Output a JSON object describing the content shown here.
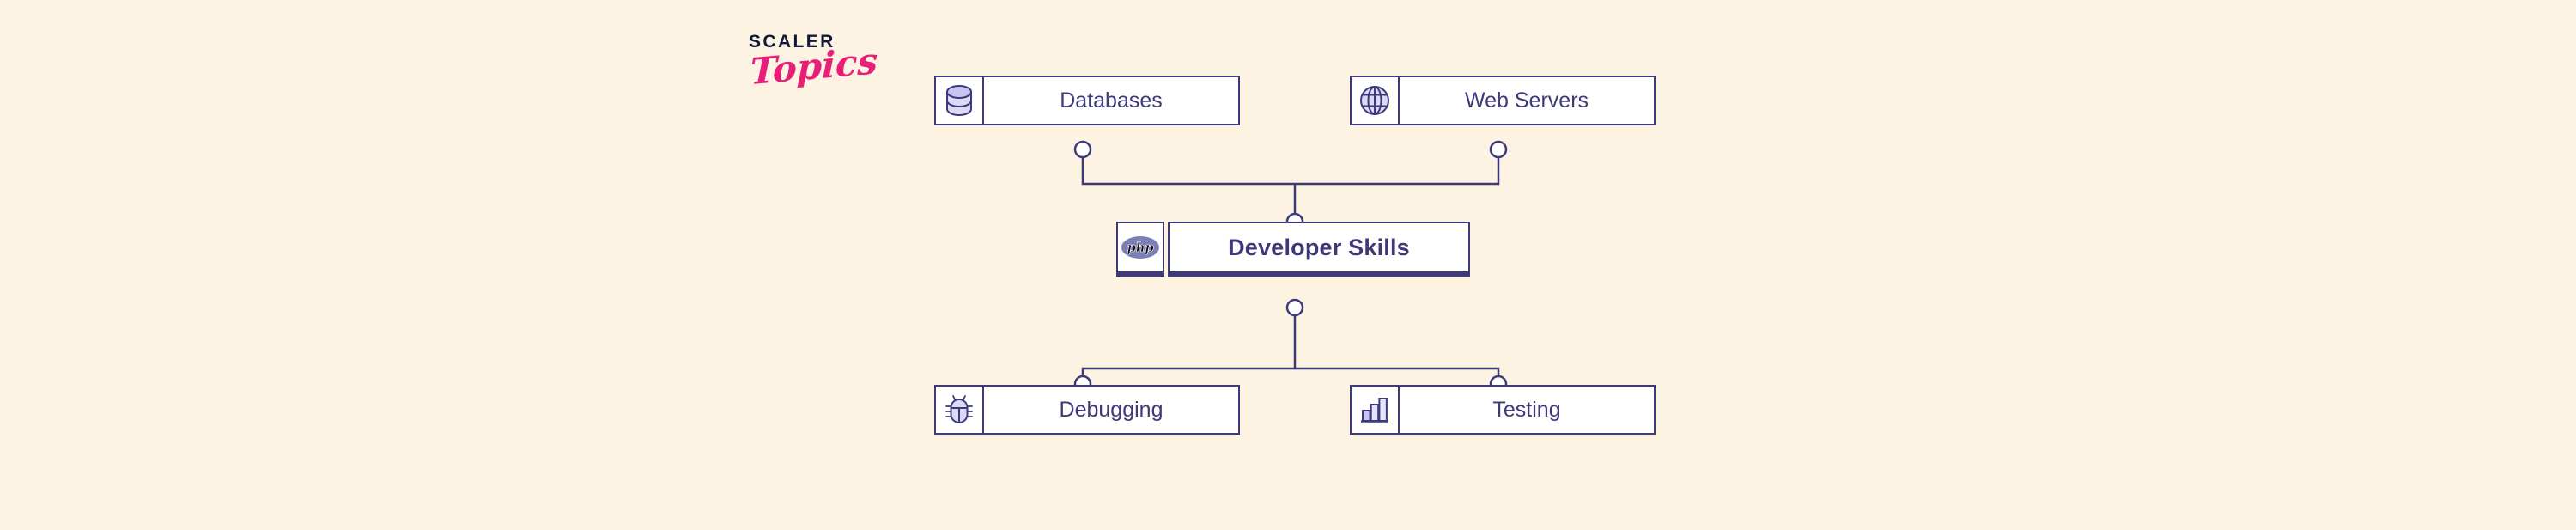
{
  "background_color": "#fdf3e3",
  "accent_color": "#3e3a7a",
  "icon_fill_color": "#dcdaf6",
  "logo": {
    "line1": "SCALER",
    "line2": "Topics",
    "line1_color": "#101938",
    "line2_color": "#e91e78"
  },
  "diagram": {
    "type": "hierarchy",
    "root": "Developer Skills",
    "parents": [
      "Databases",
      "Web Servers"
    ],
    "children": [
      "Debugging",
      "Testing"
    ],
    "nodes": [
      {
        "id": "databases",
        "label": "Databases",
        "icon": "database-icon",
        "row": "top"
      },
      {
        "id": "web-servers",
        "label": "Web Servers",
        "icon": "globe-icon",
        "row": "top"
      },
      {
        "id": "center",
        "label": "Developer Skills",
        "icon": "php-logo-icon",
        "row": "center"
      },
      {
        "id": "debugging",
        "label": "Debugging",
        "icon": "bug-icon",
        "row": "bottom"
      },
      {
        "id": "testing",
        "label": "Testing",
        "icon": "bar-chart-icon",
        "row": "bottom"
      }
    ]
  }
}
